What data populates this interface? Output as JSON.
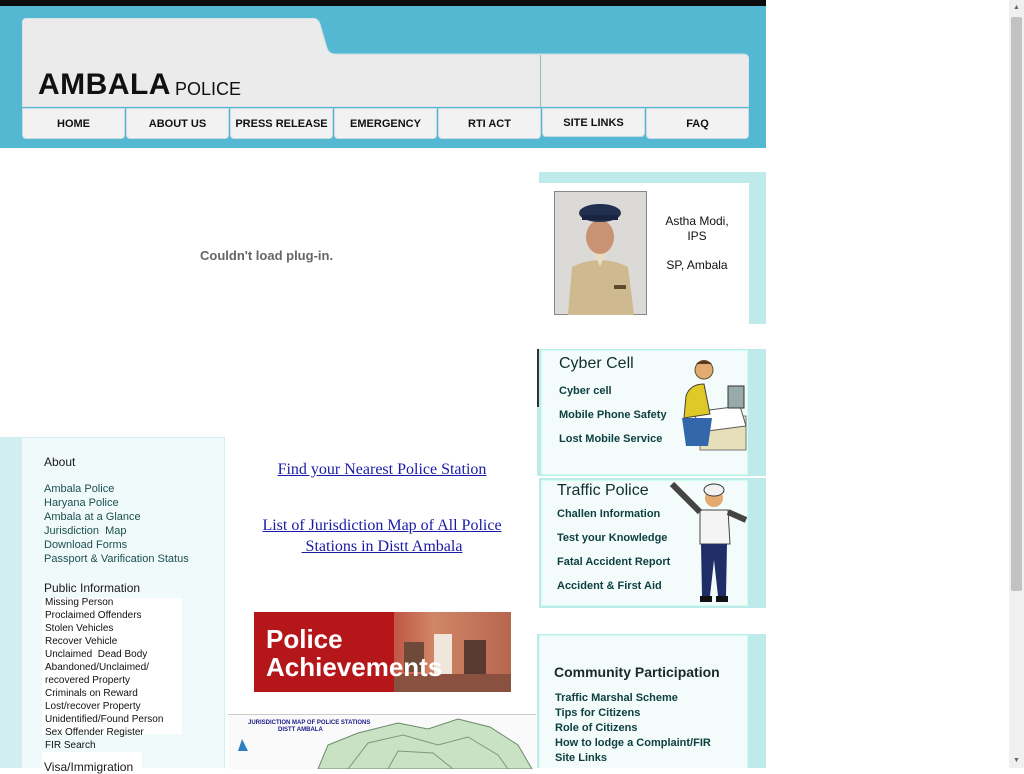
{
  "brand": {
    "main": "AMBALA",
    "sub": "POLICE"
  },
  "nav": [
    "HOME",
    "ABOUT US",
    "PRESS RELEASE",
    "EMERGENCY",
    "RTI ACT",
    "SITE LINKS",
    "FAQ"
  ],
  "plugin_message": "Couldn't load plug-in.",
  "sp_card": {
    "name": "Astha Modi,",
    "rank": "IPS",
    "post": "SP, Ambala"
  },
  "cyber_cell": {
    "title": "Cyber Cell",
    "links": [
      "Cyber cell",
      "Mobile Phone Safety",
      "Lost Mobile Service"
    ]
  },
  "traffic_police": {
    "title": "Traffic Police",
    "links": [
      "Challen Information",
      "Test your Knowledge",
      "Fatal Accident Report",
      "Accident & First Aid"
    ]
  },
  "community": {
    "title": "Community Participation",
    "links": [
      "Traffic Marshal Scheme",
      "Tips for Citizens",
      "Role of Citizens",
      "How to lodge a Complaint/FIR",
      "Site Links"
    ]
  },
  "center_links": {
    "nearest": "Find your Nearest Police Station",
    "jurisdiction_line1": "List of Jurisdiction Map of All Police",
    "jurisdiction_line2": " Stations in Distt Ambala"
  },
  "achievements_banner": {
    "line1": "Police",
    "line2": "Achievements"
  },
  "map_thumb": {
    "title1": "JURISDICTION MAP OF POLICE STATIONS",
    "title2": "DISTT AMBALA"
  },
  "about": {
    "heading": "About",
    "links": [
      "Ambala Police",
      "Haryana Police",
      "Ambala at a Glance",
      "Jurisdiction  Map",
      "Download Forms",
      "Passport & Varification Status"
    ]
  },
  "public_info": {
    "heading": "Public Information",
    "links": [
      "Missing Person",
      "Proclaimed Offenders",
      "Stolen Vehicles",
      "Recover Vehicle",
      "Unclaimed  Dead Body",
      "Abandoned/Unclaimed/",
      "recovered Property",
      "Criminals on Reward",
      "Lost/recover Property",
      "Unidentified/Found Person",
      "Sex Offender Register",
      "FIR Search"
    ]
  },
  "visa": {
    "heading": "Visa/Immigration"
  },
  "colors": {
    "header_bg": "#55b8d3",
    "panel_bg": "#bfeaec",
    "link_teal": "#0e4040",
    "link_blue": "#1a1aa6",
    "banner_red": "#b5161a"
  }
}
